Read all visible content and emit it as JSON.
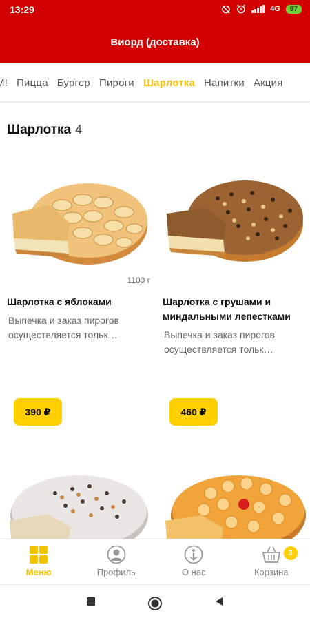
{
  "status_bar": {
    "time": "13:29",
    "network": "4G",
    "battery": "97",
    "icons": [
      "alarm-off-icon",
      "alarm-clock-icon",
      "signal-icon",
      "battery-icon"
    ]
  },
  "app": {
    "title": "Виорд (доставка)",
    "bar_color": "#d20000",
    "accent": "#ffcf00"
  },
  "tabs": [
    {
      "label": "М!"
    },
    {
      "label": "Пицца"
    },
    {
      "label": "Бургер"
    },
    {
      "label": "Пироги"
    },
    {
      "label": "Шарлотка",
      "active": true
    },
    {
      "label": "Напитки"
    },
    {
      "label": "Акция"
    }
  ],
  "section": {
    "title": "Шарлотка",
    "count": "4"
  },
  "products": [
    {
      "name": "Шарлотка с яблоками",
      "description": "Выпечка и заказ пирогов осуществляется тольк…",
      "weight": "1100 г",
      "price": "390 ₽"
    },
    {
      "name": "Шарлотка с грушами и миндальными лепестками",
      "description": "Выпечка и заказ пирогов осуществляется тольк…",
      "price": "460 ₽"
    }
  ],
  "bottom_nav": [
    {
      "label": "Меню",
      "icon": "menu-grid-icon",
      "active": true
    },
    {
      "label": "Профиль",
      "icon": "profile-icon"
    },
    {
      "label": "О нас",
      "icon": "about-icon"
    },
    {
      "label": "Корзина",
      "icon": "basket-icon",
      "badge": "3"
    }
  ]
}
